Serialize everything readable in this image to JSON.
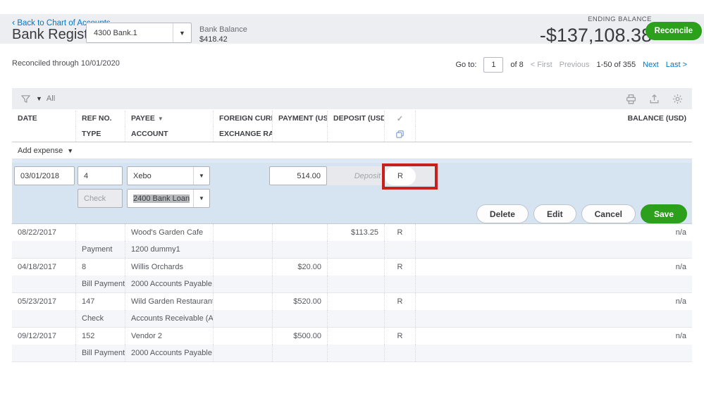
{
  "colors": {
    "accent_green": "#2ca01c",
    "link_blue": "#0077c5",
    "annotation_red": "#c8201d",
    "edit_row_blue": "#d6e4f2"
  },
  "header": {
    "back_link": "Back to Chart of Accounts",
    "title": "Bank Register",
    "account_selector_value": "4300 Bank.1",
    "bank_balance_label": "Bank Balance",
    "bank_balance_value": "$418.42",
    "ending_balance_label": "ENDING BALANCE",
    "ending_balance_value": "-$137,108.38",
    "reconcile_button_label": "Reconcile"
  },
  "subheader": {
    "reconciled_through": "Reconciled through 10/01/2020",
    "pagination": {
      "go_to_label": "Go to:",
      "page_value": "1",
      "page_total": "of 8",
      "first_label": "< First",
      "previous_label": "Previous",
      "range_label": "1-50 of 355",
      "next_label": "Next",
      "last_label": "Last >"
    }
  },
  "toolbar": {
    "filter_label": "All"
  },
  "table": {
    "columns": {
      "date": "DATE",
      "ref_no": "REF NO.",
      "type": "TYPE",
      "payee": "PAYEE",
      "account": "ACCOUNT",
      "foreign_currency": "FOREIGN CURRENCY",
      "exchange_rate": "EXCHANGE RATE",
      "payment": "PAYMENT (USD)",
      "deposit": "DEPOSIT (USD)",
      "check_mark": "✓",
      "balance": "BALANCE (USD)"
    },
    "add_expense_label": "Add expense",
    "edit_row": {
      "date": "03/01/2018",
      "ref_no": "4",
      "payee": "Xebo",
      "type": "Check",
      "account": "2400 Bank Loan",
      "payment": "514.00",
      "deposit_placeholder": "Deposit",
      "reconcile_status": "R"
    },
    "edit_actions": {
      "delete_label": "Delete",
      "edit_label": "Edit",
      "cancel_label": "Cancel",
      "save_label": "Save"
    },
    "rows": [
      {
        "date": "08/22/2017",
        "ref_no": "",
        "type": "Payment",
        "payee": "Wood's Garden Cafe",
        "account": "1200 dummy1",
        "payment": "",
        "deposit": "$113.25",
        "status": "R",
        "balance": "n/a"
      },
      {
        "date": "04/18/2017",
        "ref_no": "8",
        "type": "Bill Payment",
        "payee": "Willis Orchards",
        "account": "2000 Accounts Payable",
        "payment": "$20.00",
        "deposit": "",
        "status": "R",
        "balance": "n/a"
      },
      {
        "date": "05/23/2017",
        "ref_no": "147",
        "type": "Check",
        "payee": "Wild Garden Restaurant",
        "account": "Accounts Receivable (A...",
        "payment": "$520.00",
        "deposit": "",
        "status": "R",
        "balance": "n/a"
      },
      {
        "date": "09/12/2017",
        "ref_no": "152",
        "type": "Bill Payment",
        "payee": "Vendor 2",
        "account": "2000 Accounts Payable",
        "payment": "$500.00",
        "deposit": "",
        "status": "R",
        "balance": "n/a"
      }
    ]
  }
}
